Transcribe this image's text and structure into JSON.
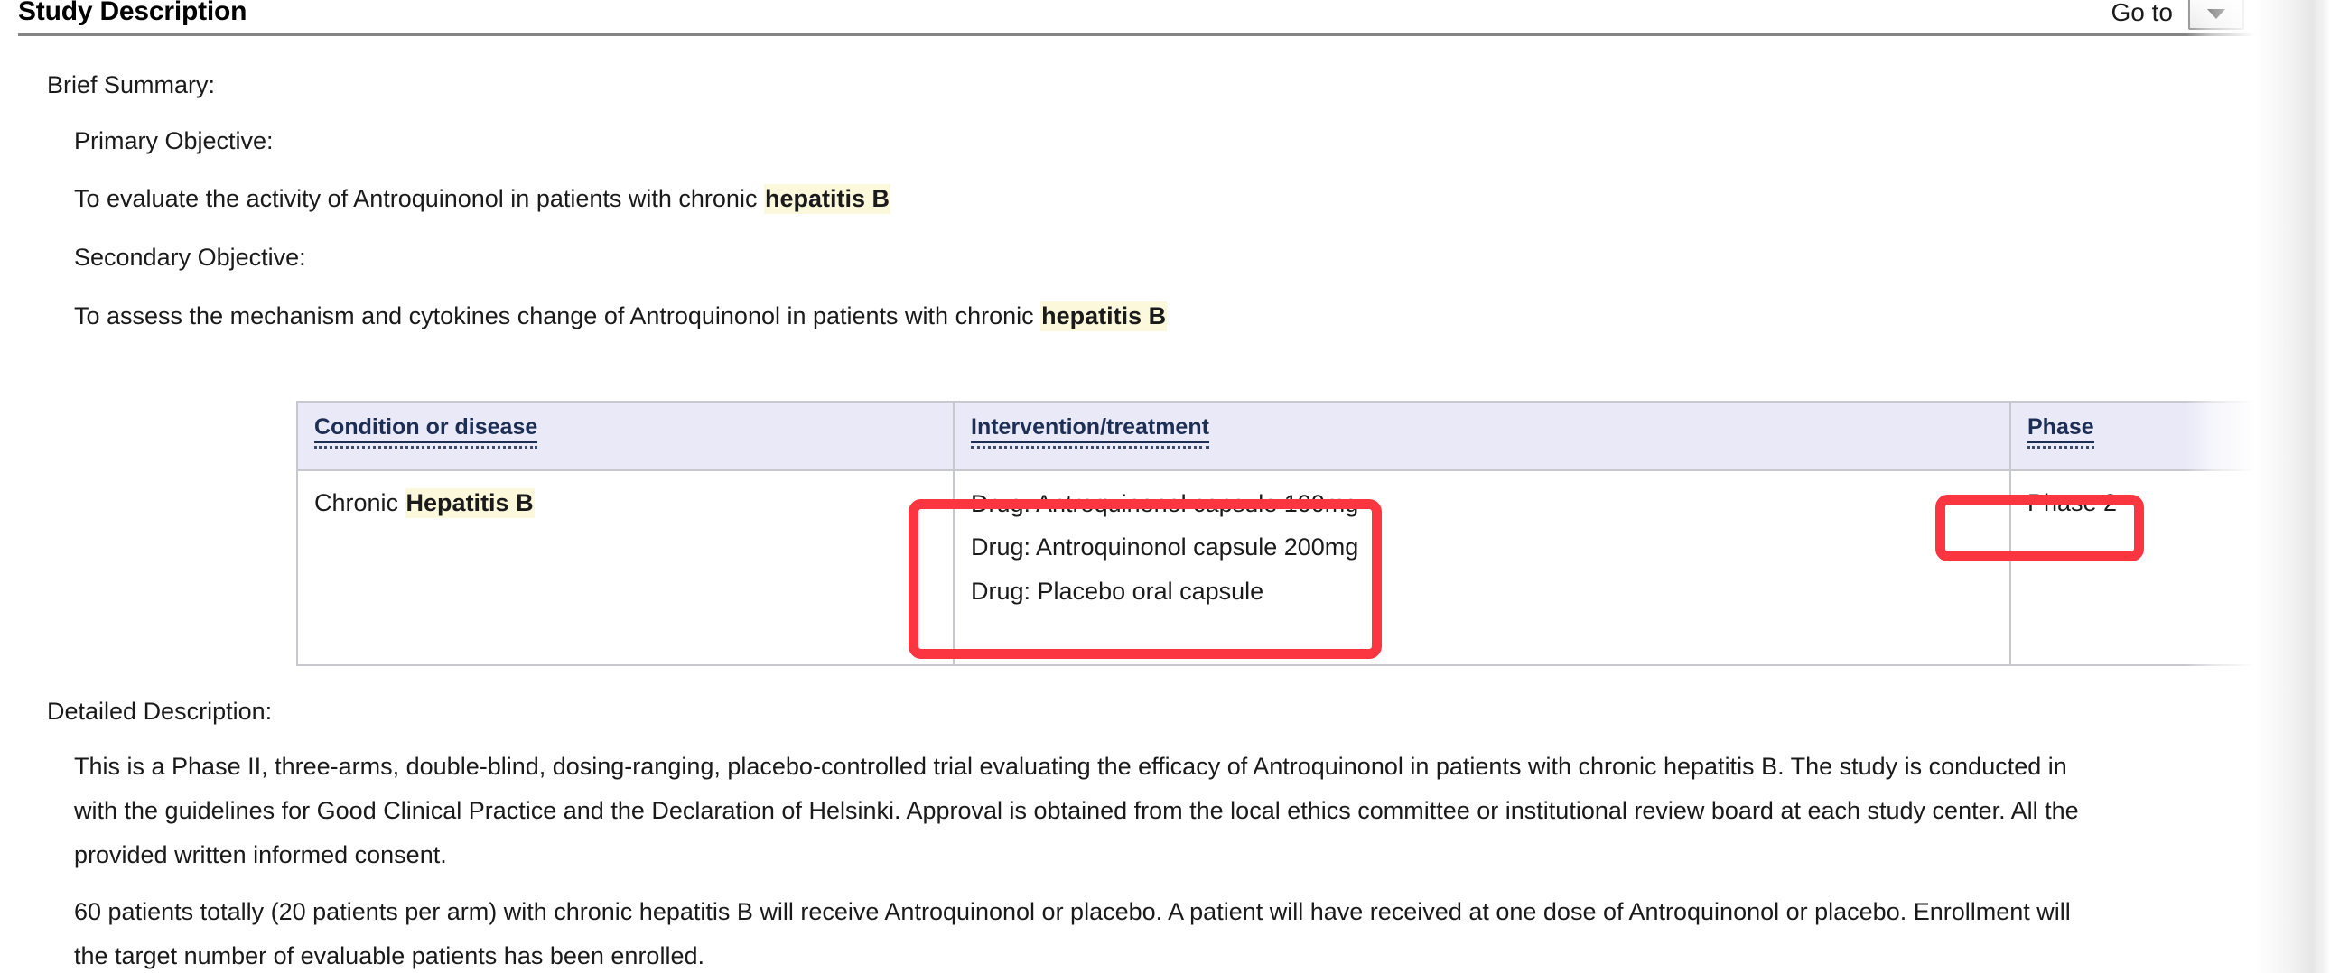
{
  "header": {
    "title": "Study Description",
    "goto_label": "Go to",
    "goto_caret_icon": "chevron-down-icon"
  },
  "brief_summary": {
    "label": "Brief Summary:",
    "primary_objective_label": "Primary Objective:",
    "primary_objective_text_before": "To evaluate the activity of Antroquinonol in patients with chronic ",
    "primary_objective_highlight": "hepatitis B",
    "secondary_objective_label": "Secondary Objective:",
    "secondary_objective_text_before": "To assess the mechanism and cytokines change of Antroquinonol in patients with chronic ",
    "secondary_objective_highlight": "hepatitis B"
  },
  "table": {
    "headers": [
      "Condition or disease",
      "Intervention/treatment",
      "Phase"
    ],
    "condition_prefix": "Chronic ",
    "condition_highlight": "Hepatitis B",
    "interventions": [
      "Drug: Antroquinonol capsule 100mg",
      "Drug: Antroquinonol capsule 200mg",
      "Drug: Placebo oral capsule"
    ],
    "phase": "Phase 2"
  },
  "detailed_description": {
    "label": "Detailed Description:",
    "paragraph1_lines": [
      "This is a Phase II, three-arms, double-blind, dosing-ranging, placebo-controlled trial evaluating the efficacy of Antroquinonol in patients with chronic hepatitis B. The study is conducted in",
      "with the guidelines for Good Clinical Practice and the Declaration of Helsinki. Approval is obtained from the local ethics committee or institutional review board at each study center. All the",
      "provided written informed consent."
    ],
    "paragraph2_lines": [
      "60 patients totally (20 patients per arm) with chronic hepatitis B will receive Antroquinonol or placebo. A patient will have received at one dose of Antroquinonol or placebo. Enrollment will",
      "the target number of evaluable patients has been enrolled."
    ]
  },
  "annotations": {
    "color": "#fb3640",
    "boxes": [
      "interventions-highlight-box",
      "phase-highlight-box"
    ]
  },
  "colors": {
    "table_header_bg": "#e9e9f8",
    "table_header_text": "#1c2e54",
    "table_border": "#c8c8cf",
    "highlight_bg": "#fbf8dc",
    "annotation_red": "#fb3640",
    "rule_gray": "#858585"
  }
}
